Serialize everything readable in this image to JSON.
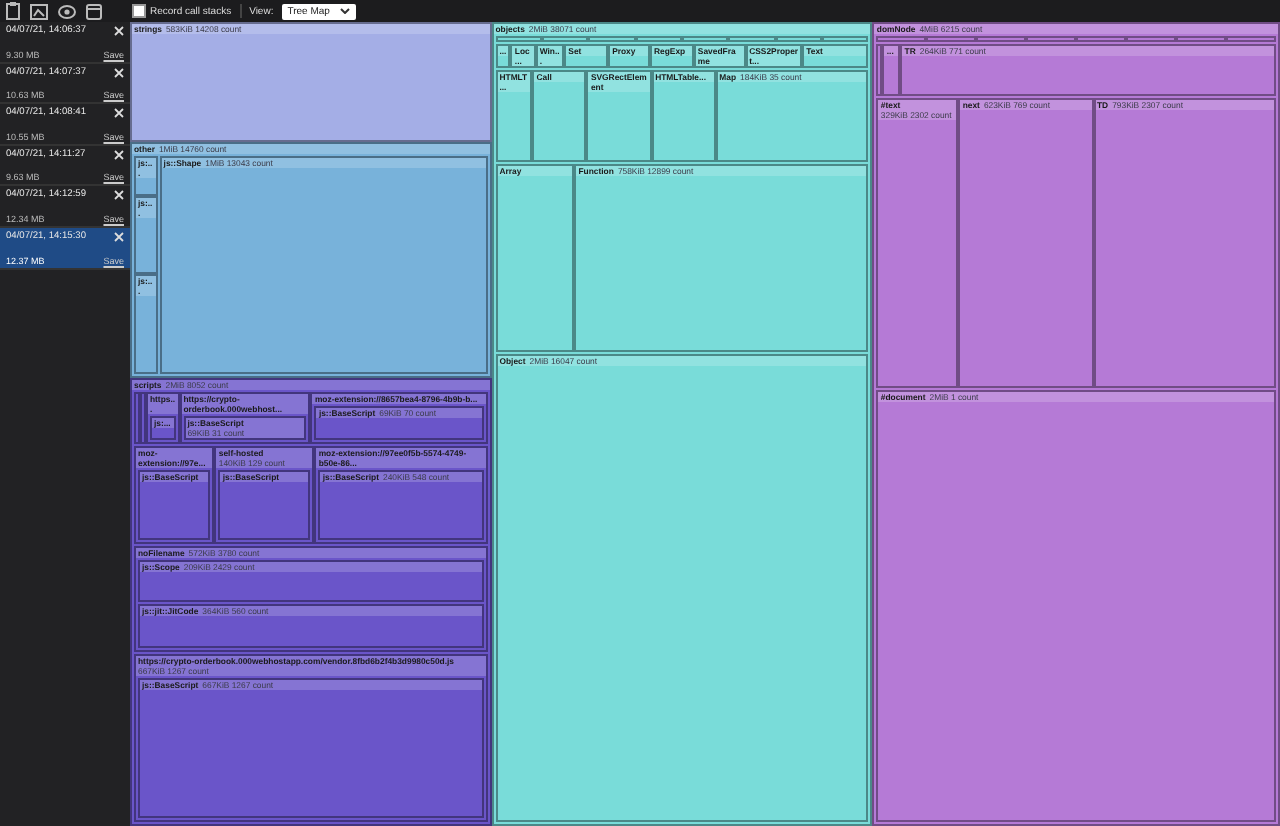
{
  "toolbar": {
    "record_call_stacks": {
      "label": "Record call stacks",
      "checked": false
    },
    "view_label": "View:",
    "view_select": {
      "value": "Tree Map"
    }
  },
  "snapshots": [
    {
      "time": "04/07/21, 14:06:37",
      "size": "9.30 MB",
      "action": "Save",
      "selected": false
    },
    {
      "time": "04/07/21, 14:07:37",
      "size": "10.63 MB",
      "action": "Save",
      "selected": false
    },
    {
      "time": "04/07/21, 14:08:41",
      "size": "10.55 MB",
      "action": "Save",
      "selected": false
    },
    {
      "time": "04/07/21, 14:11:27",
      "size": "9.63 MB",
      "action": "Save",
      "selected": false
    },
    {
      "time": "04/07/21, 14:12:59",
      "size": "12.34 MB",
      "action": "Save",
      "selected": false
    },
    {
      "time": "04/07/21, 14:15:30",
      "size": "12.37 MB",
      "action": "Save",
      "selected": true
    }
  ],
  "treemap": {
    "nodes": [
      {
        "name": "strings",
        "info": "583KiB 14208 count",
        "color": "#a4aee6"
      },
      {
        "name": "other",
        "info": "1MiB 14760 count",
        "color": "#78b2da",
        "children": [
          {
            "name": "js:..."
          },
          {
            "name": "js:..."
          },
          {
            "name": "js:..."
          },
          {
            "name": "js::Shape",
            "info": "1MiB 13043 count"
          }
        ]
      },
      {
        "name": "scripts",
        "info": "2MiB 8052 count",
        "color": "#6a55c9",
        "children": [
          {
            "name": "https...",
            "children": [
              {
                "name": "js:..."
              }
            ]
          },
          {
            "name": "https://crypto-orderbook.000webhost...",
            "children": [
              {
                "name": "js::BaseScript",
                "info": "69KiB 31 count"
              }
            ]
          },
          {
            "name": "moz-extension://8657bea4-8796-4b9b-b...",
            "children": [
              {
                "name": "js::BaseScript",
                "info": "69KiB 70 count"
              }
            ]
          },
          {
            "name": "moz-extension://97e...",
            "children": [
              {
                "name": "js::BaseScript"
              }
            ]
          },
          {
            "name": "self-hosted",
            "info": "140KiB 129 count",
            "children": [
              {
                "name": "js::BaseScript"
              }
            ]
          },
          {
            "name": "moz-extension://97ee0f5b-5574-4749-b50e-86...",
            "children": [
              {
                "name": "js::BaseScript",
                "info": "240KiB 548 count"
              }
            ]
          },
          {
            "name": "noFilename",
            "info": "572KiB 3780 count",
            "children": [
              {
                "name": "js::Scope",
                "info": "209KiB 2429 count"
              },
              {
                "name": "js::jit::JitCode",
                "info": "364KiB 560 count"
              }
            ]
          },
          {
            "name": "https://crypto-orderbook.000webhostapp.com/vendor.8fbd6b2f4b3d9980c50d.js",
            "info": "667KiB 1267 count",
            "children": [
              {
                "name": "js::BaseScript",
                "info": "667KiB 1267 count"
              }
            ]
          }
        ]
      },
      {
        "name": "objects",
        "info": "2MiB 38071 count",
        "color": "#79dcd9",
        "children": [
          {
            "name": "..."
          },
          {
            "name": "Loc..."
          },
          {
            "name": "Win..."
          },
          {
            "name": "Set"
          },
          {
            "name": "Proxy"
          },
          {
            "name": "RegExp"
          },
          {
            "name": "SavedFrame"
          },
          {
            "name": "CSS2Propert..."
          },
          {
            "name": "Text"
          },
          {
            "name": "HTMLT..."
          },
          {
            "name": "Call"
          },
          {
            "name": "SVGRectElement"
          },
          {
            "name": "HTMLTable..."
          },
          {
            "name": "Map",
            "info": "184KiB 35 count"
          },
          {
            "name": "Array"
          },
          {
            "name": "Function",
            "info": "758KiB 12899 count"
          },
          {
            "name": "Object",
            "info": "2MiB 16047 count"
          }
        ]
      },
      {
        "name": "domNode",
        "info": "4MiB 6215 count",
        "color": "#b57ad6",
        "children": [
          {
            "name": "..."
          },
          {
            "name": "TR",
            "info": "264KiB 771 count"
          },
          {
            "name": "#text",
            "info": "329KiB 2302 count"
          },
          {
            "name": "next",
            "info": "623KiB 769 count"
          },
          {
            "name": "TD",
            "info": "793KiB 2307 count"
          },
          {
            "name": "#document",
            "info": "2MiB 1 count"
          }
        ]
      }
    ]
  }
}
